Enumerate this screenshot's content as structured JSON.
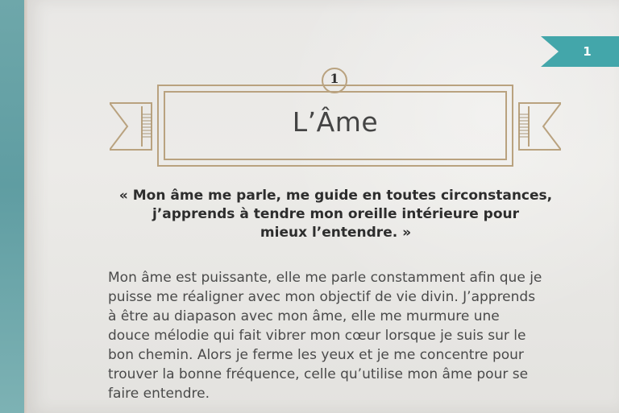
{
  "page": {
    "chapter_marker": "1",
    "chapter_number": "1",
    "chapter_title": "L’Âme"
  },
  "quote_lines": [
    "« Mon âme me parle, me guide en toutes circonstances,",
    "j’apprends à tendre mon oreille intérieure pour",
    "mieux l’entendre. »"
  ],
  "body_lines": [
    "Mon âme est puissante, elle me parle constamment afin que je",
    "puisse me réaligner avec mon objectif de vie divin. J’apprends",
    "à être au diapason avec mon âme, elle me murmure une",
    "douce mélodie qui fait vibrer mon cœur lorsque je suis sur le",
    "bon chemin. Alors je ferme les yeux et je me concentre pour",
    "trouver la bonne fréquence, celle qu’utilise mon âme pour se",
    "faire entendre."
  ],
  "colors": {
    "accent": "#43a6aa",
    "banner_line": "#b9a27f",
    "cover": "#6ea7aa",
    "paper": "#ebeae7"
  }
}
